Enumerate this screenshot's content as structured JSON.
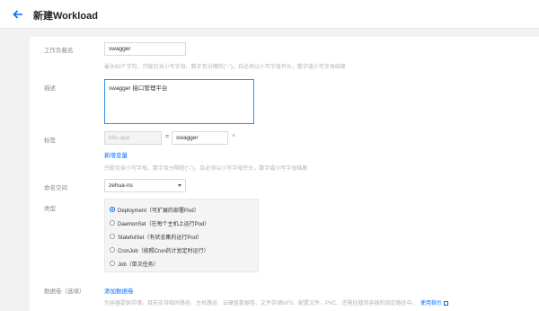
{
  "header": {
    "title": "新建Workload"
  },
  "form": {
    "name": {
      "label": "工作负载名",
      "value": "swagger",
      "hint": "最长63个字符，只能包含小写字母、数字及分隔符(\"-\")，且必须以小写字母开头，数字或小写字母结尾"
    },
    "description": {
      "label": "描述",
      "value": "swagger 接口管理平台"
    },
    "labels": {
      "label": "标签",
      "key": "k8s-app",
      "equals": "=",
      "value": "swagger",
      "remove": "×",
      "add_link": "新增变量",
      "hint": "只能包含小写字母、数字及分隔符(\"-\")，且必须以小写字母开头，数字或小写字母结尾"
    },
    "namespace": {
      "label": "命名空间",
      "value": "zehua-ns"
    },
    "type": {
      "label": "类型",
      "options": [
        {
          "label": "Deployment（可扩展的部署Pod）",
          "checked": true
        },
        {
          "label": "DaemonSet（在每个主机上运行Pod）",
          "checked": false
        },
        {
          "label": "StatefulSet（有状态集的运行Pod）",
          "checked": false
        },
        {
          "label": "CronJob（按照Cron的计划定时运行）",
          "checked": false
        },
        {
          "label": "Job（单次任务）",
          "checked": false
        }
      ]
    },
    "volumes": {
      "label": "数据卷（选填）",
      "add_link": "添加数据卷",
      "hint": "为容器提供存储，目前支持临时路径、主机路径、云硬盘数据卷、文件存储NFS、配置文件、PVC，还需挂载到容器的指定路径中。",
      "guide_link": "使用指引"
    }
  }
}
